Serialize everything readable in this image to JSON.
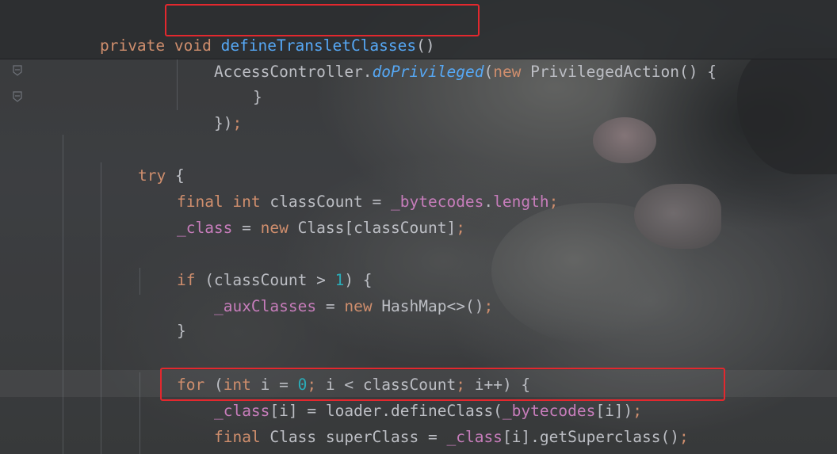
{
  "editor": {
    "lines": {
      "l1": {
        "kw1": "private ",
        "kw2": "void ",
        "name": "defineTransletClasses",
        "punct": "()"
      },
      "l2": {
        "cls": "AccessController.",
        "method": "doPrivileged",
        "open": "(",
        "kw": "new ",
        "type": "PrivilegedAction",
        "rest": "() {"
      },
      "l3": {
        "text": "}"
      },
      "l4": {
        "text": "})",
        "semi": ";"
      },
      "l5": {
        "kw": "try",
        "rest": " {"
      },
      "l6": {
        "kw1": "final ",
        "kw2": "int ",
        "var": "classCount = ",
        "field": "_bytecodes",
        "dot": ".",
        "prop": "length",
        "semi": ";"
      },
      "l7": {
        "field": "_class",
        "eq": " = ",
        "kw": "new ",
        "rest": "Class[classCount]",
        "semi": ";"
      },
      "l8": {
        "kw": "if",
        "pre": " (classCount > ",
        "num": "1",
        "post": ") {"
      },
      "l9": {
        "field": "_auxClasses",
        "eq": " = ",
        "kw": "new ",
        "rest": "HashMap<>()",
        "semi": ";"
      },
      "l10": {
        "text": "}"
      },
      "l11": {
        "kw1": "for",
        "p1": " (",
        "kw2": "int",
        "p2": " i = ",
        "num": "0",
        "semi1": ";",
        "p3": " i < classCount",
        "semi2": ";",
        "p4": " i++) {"
      },
      "l12": {
        "field": "_class",
        "p1": "[i] = loader.defineClass(",
        "field2": "_bytecodes",
        "p2": "[i])",
        "semi": ";"
      },
      "l13": {
        "kw": "final ",
        "p1": "Class superClass = ",
        "field": "_class",
        "p2": "[i].getSuperclass()",
        "semi": ";"
      }
    }
  },
  "colors": {
    "keyword": "#cf8e6d",
    "method": "#56a8f5",
    "field": "#c77dbb",
    "number": "#2aacb8",
    "text": "#bcbec4",
    "annotation_box": "#e3282e"
  },
  "icons": [
    "fold-end-icon",
    "fold-end-icon"
  ]
}
